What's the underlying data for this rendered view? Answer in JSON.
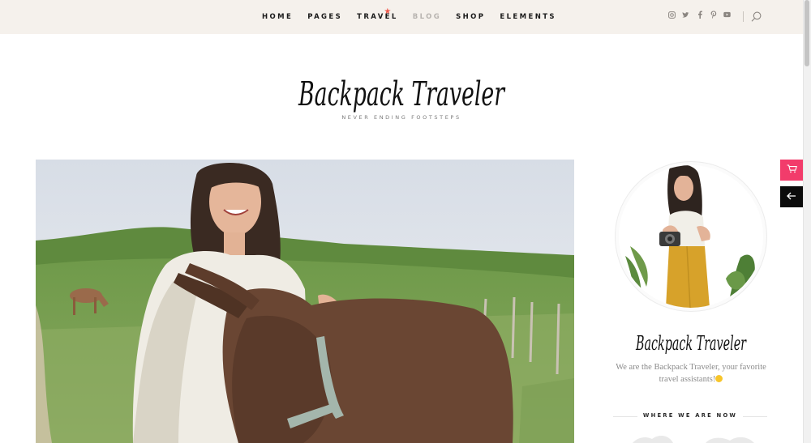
{
  "nav": {
    "items": [
      {
        "label": "HOME",
        "name": "nav-home"
      },
      {
        "label": "PAGES",
        "name": "nav-pages"
      },
      {
        "label": "TRAVEL",
        "name": "nav-travel",
        "badge": "★"
      },
      {
        "label": "BLOG",
        "name": "nav-blog",
        "muted": true
      },
      {
        "label": "SHOP",
        "name": "nav-shop"
      },
      {
        "label": "ELEMENTS",
        "name": "nav-elements"
      }
    ]
  },
  "social": [
    "instagram-icon",
    "twitter-icon",
    "facebook-icon",
    "pinterest-icon",
    "youtube-icon"
  ],
  "header": {
    "logo": "Backpack Traveler",
    "tagline": "NEVER ENDING FOOTSTEPS"
  },
  "sidebar": {
    "logo": "Backpack Traveler",
    "bio": "We are the Backpack Traveler, your favorite travel assistants!",
    "where_title": "WHERE WE ARE NOW"
  },
  "colors": {
    "topbar_bg": "#f5f1ec",
    "accent_pink": "#f23c6b",
    "star_red": "#f0584a",
    "dark_button": "#0b0b0b"
  }
}
